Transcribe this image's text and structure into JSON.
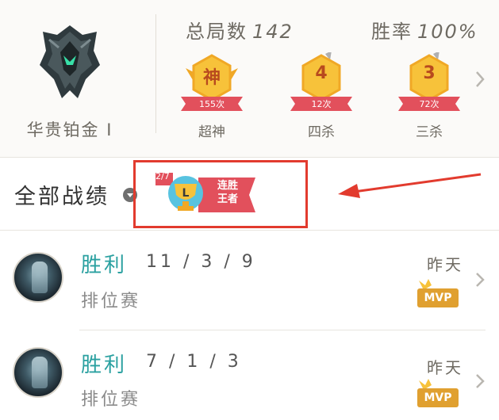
{
  "rank": {
    "label": "华贵铂金 I",
    "emblem_icon": "platinum-rank-emblem"
  },
  "stats": {
    "total_label": "总局数",
    "total_value": "142",
    "winrate_label": "胜率",
    "winrate_value": "100%"
  },
  "badges": [
    {
      "char": "神",
      "count": "155次",
      "title": "超神"
    },
    {
      "char": "4",
      "count": "12次",
      "title": "四杀"
    },
    {
      "char": "3",
      "count": "72次",
      "title": "三杀"
    }
  ],
  "records": {
    "title": "全部战绩",
    "streak_count": "2/7",
    "streak_label_line1": "连胜",
    "streak_label_line2": "王者"
  },
  "matches": [
    {
      "result": "胜利",
      "kda": "11 / 3 / 9",
      "mode": "排位赛",
      "when": "昨天",
      "mvp": "MVP"
    },
    {
      "result": "胜利",
      "kda": "7 / 1 / 3",
      "mode": "排位赛",
      "when": "昨天",
      "mvp": "MVP"
    }
  ],
  "colors": {
    "accent_win": "#2aa0a0",
    "badge_gold": "#f7c23a",
    "ribbon_red": "#e2505c",
    "annotation_red": "#e23b2e"
  }
}
